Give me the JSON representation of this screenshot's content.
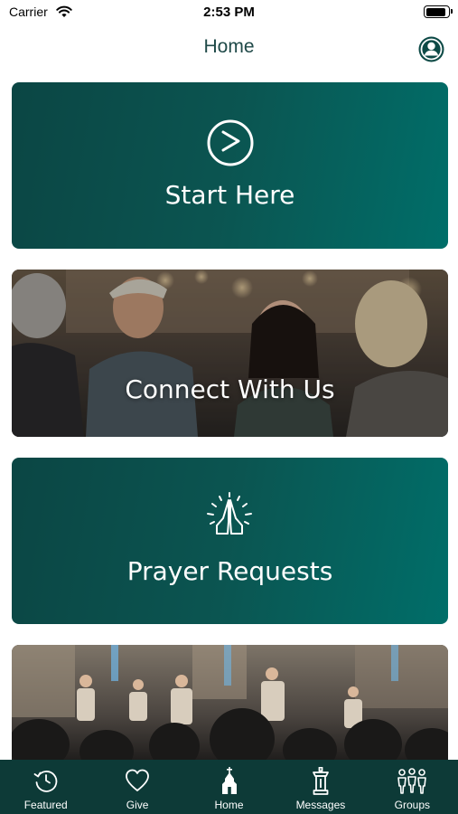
{
  "status_bar": {
    "carrier": "Carrier",
    "time": "2:53 PM",
    "battery_level": 0.9
  },
  "nav": {
    "title": "Home",
    "profile_icon": "person-circle-icon"
  },
  "colors": {
    "brand_teal": "#0b4e4b",
    "brand_teal_light": "#006e69",
    "tab_bar": "#0d3a37",
    "nav_title": "#1f4948"
  },
  "cards": [
    {
      "label": "Start Here",
      "icon": "play-circle-icon",
      "kind": "teal"
    },
    {
      "label": "Connect With Us",
      "icon": null,
      "kind": "photo"
    },
    {
      "label": "Prayer Requests",
      "icon": "praying-hands-icon",
      "kind": "teal"
    },
    {
      "label": "",
      "icon": null,
      "kind": "photo"
    }
  ],
  "tabs": [
    {
      "label": "Featured",
      "icon": "history-icon"
    },
    {
      "label": "Give",
      "icon": "heart-icon"
    },
    {
      "label": "Home",
      "icon": "church-icon"
    },
    {
      "label": "Messages",
      "icon": "pulpit-icon"
    },
    {
      "label": "Groups",
      "icon": "people-icon"
    }
  ]
}
